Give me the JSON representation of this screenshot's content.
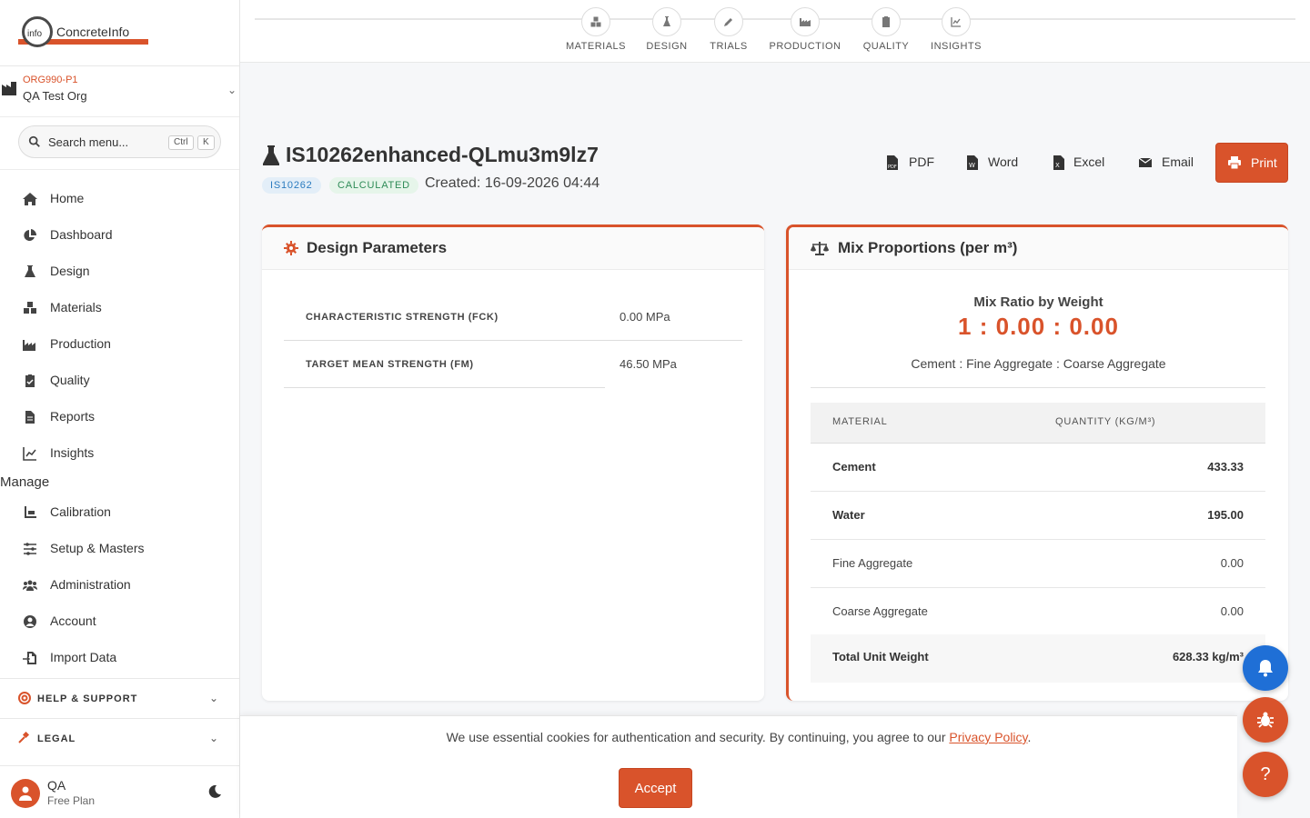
{
  "app": {
    "logo_text": "ConcreteInfo",
    "logo_badge": "info"
  },
  "org": {
    "code": "ORG990-P1",
    "name": "QA Test Org"
  },
  "search": {
    "placeholder": "Search menu...",
    "kbd1": "Ctrl",
    "kbd2": "K"
  },
  "nav": {
    "items": [
      {
        "label": "Home",
        "icon": "home-icon"
      },
      {
        "label": "Dashboard",
        "icon": "pie-chart-icon"
      },
      {
        "label": "Design",
        "icon": "flask-icon"
      },
      {
        "label": "Materials",
        "icon": "cubes-icon"
      },
      {
        "label": "Production",
        "icon": "factory-icon"
      },
      {
        "label": "Quality",
        "icon": "clipboard-check-icon"
      },
      {
        "label": "Reports",
        "icon": "file-icon"
      },
      {
        "label": "Insights",
        "icon": "line-chart-icon"
      }
    ],
    "manage_label": "Manage",
    "manage_items": [
      {
        "label": "Calibration",
        "icon": "scale-icon"
      },
      {
        "label": "Setup & Masters",
        "icon": "sliders-icon"
      },
      {
        "label": "Administration",
        "icon": "users-icon"
      },
      {
        "label": "Account",
        "icon": "user-circle-icon"
      },
      {
        "label": "Import Data",
        "icon": "file-import-icon"
      }
    ]
  },
  "help": {
    "label": "HELP & SUPPORT"
  },
  "legal": {
    "label": "LEGAL"
  },
  "user": {
    "name": "QA",
    "plan": "Free Plan"
  },
  "stepper": [
    "MATERIALS",
    "DESIGN",
    "TRIALS",
    "PRODUCTION",
    "QUALITY",
    "INSIGHTS"
  ],
  "header": {
    "title": "IS10262enhanced-QLmu3m9lz7",
    "badge_standard": "IS10262",
    "badge_status": "CALCULATED",
    "created": "Created: 16-09-2026 04:44"
  },
  "actions": {
    "pdf": "PDF",
    "word": "Word",
    "excel": "Excel",
    "email": "Email",
    "print": "Print"
  },
  "design_params": {
    "title": "Design Parameters",
    "rows": [
      {
        "key": "CHARACTERISTIC STRENGTH (FCK)",
        "value": "0.00 MPa"
      },
      {
        "key": "TARGET MEAN STRENGTH (FM)",
        "value": "46.50 MPa"
      }
    ]
  },
  "mix": {
    "title": "Mix Proportions (per m³)",
    "ratio_label": "Mix Ratio by Weight",
    "ratio_value": "1 : 0.00 : 0.00",
    "ratio_desc": "Cement : Fine Aggregate : Coarse Aggregate",
    "col_material": "MATERIAL",
    "col_quantity": "QUANTITY (KG/M³)",
    "rows": [
      {
        "name": "Cement",
        "value": "433.33"
      },
      {
        "name": "Water",
        "value": "195.00"
      },
      {
        "name": "Fine Aggregate",
        "value": "0.00"
      },
      {
        "name": "Coarse Aggregate",
        "value": "0.00"
      }
    ],
    "total_label": "Total Unit Weight",
    "total_value": "628.33 kg/m³"
  },
  "cookie": {
    "text_before": "We use essential cookies for authentication and security. By continuing, you agree to our ",
    "link": "Privacy Policy",
    "text_after": ".",
    "accept": "Accept"
  },
  "fab_help": "?",
  "colors": {
    "accent": "#d9532b",
    "bell": "#1f6fd6"
  }
}
